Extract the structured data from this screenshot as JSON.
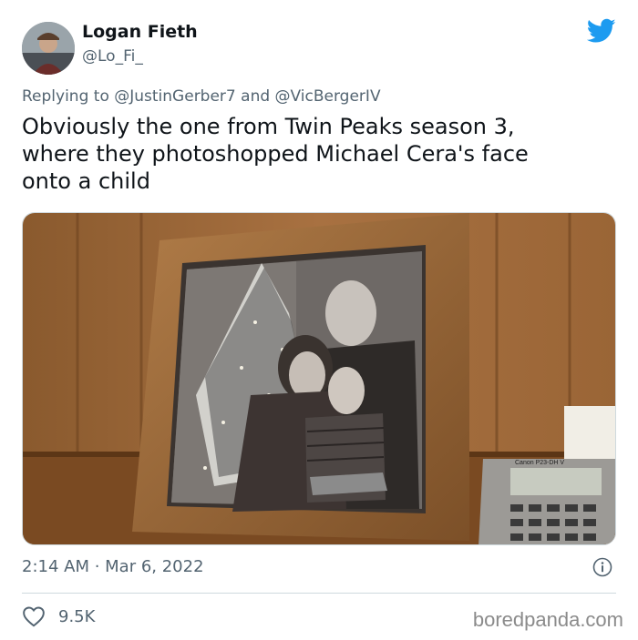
{
  "author": {
    "name": "Logan Fieth",
    "handle": "@Lo_Fi_"
  },
  "reply": {
    "prefix": "Replying to ",
    "mention1": "@JustinGerber7",
    "joiner": " and ",
    "mention2": "@VicBergerIV"
  },
  "tweet": {
    "text": "Obviously the one from Twin Peaks season 3,\nwhere they photoshopped Michael Cera's face\nonto a child",
    "timestamp": "2:14 AM · Mar 6, 2022",
    "likes": "9.5K"
  },
  "media": {
    "calculator_brand": "Canon P23-DH V"
  },
  "watermark": "boredpanda.com",
  "colors": {
    "twitter_blue": "#1d9bf0",
    "secondary_text": "#536471",
    "divider": "#cfd9de"
  },
  "icons": [
    "twitter-bird-icon",
    "info-icon",
    "heart-icon"
  ]
}
